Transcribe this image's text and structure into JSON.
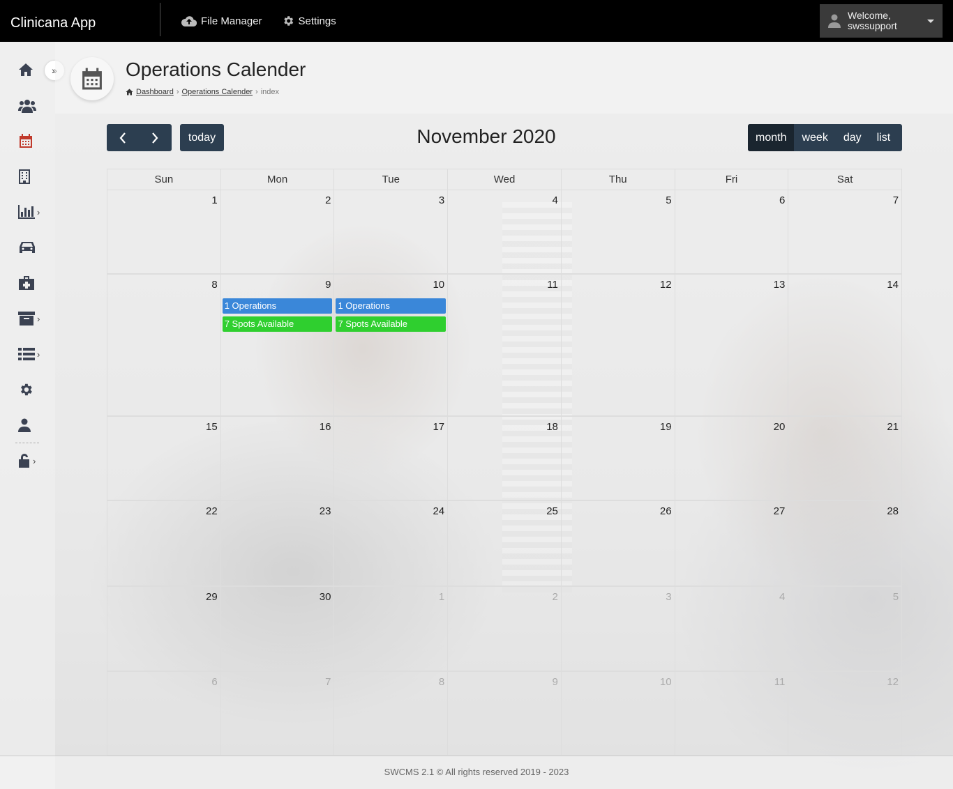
{
  "app": {
    "brand": "Clinicana App"
  },
  "topnav": {
    "file_manager": "File Manager",
    "settings": "Settings",
    "user": {
      "welcome": "Welcome,",
      "username": "swssupport"
    }
  },
  "sidebar": {
    "items": [
      {
        "icon": "home-icon"
      },
      {
        "icon": "users-icon"
      },
      {
        "icon": "calendar-icon",
        "color": "#c0392b"
      },
      {
        "icon": "building-icon"
      },
      {
        "icon": "bar-chart-icon",
        "has_submenu": true
      },
      {
        "icon": "car-icon"
      },
      {
        "icon": "medkit-icon"
      },
      {
        "icon": "archive-icon",
        "has_submenu": true
      },
      {
        "icon": "list-icon",
        "has_submenu": true
      },
      {
        "icon": "gear-icon"
      },
      {
        "icon": "user-icon"
      },
      {
        "icon": "unlock-icon",
        "has_submenu": true
      }
    ],
    "chevron": "›",
    "expand_symbol": "»"
  },
  "page": {
    "title": "Operations Calender",
    "breadcrumb": [
      "Dashboard",
      "Operations Calender",
      "index"
    ],
    "breadcrumb_sep": "›"
  },
  "calendar": {
    "title": "November 2020",
    "today_label": "today",
    "prev_symbol": "‹",
    "next_symbol": "›",
    "views": [
      "month",
      "week",
      "day",
      "list"
    ],
    "active_view": "month",
    "weekdays": [
      "Sun",
      "Mon",
      "Tue",
      "Wed",
      "Thu",
      "Fri",
      "Sat"
    ],
    "weeks": [
      [
        "1",
        "2",
        "3",
        "4",
        "5",
        "6",
        "7"
      ],
      [
        "8",
        "9",
        "10",
        "11",
        "12",
        "13",
        "14"
      ],
      [
        "15",
        "16",
        "17",
        "18",
        "19",
        "20",
        "21"
      ],
      [
        "22",
        "23",
        "24",
        "25",
        "26",
        "27",
        "28"
      ],
      [
        "29",
        "30",
        "1",
        "2",
        "3",
        "4",
        "5"
      ],
      [
        "6",
        "7",
        "8",
        "9",
        "10",
        "11",
        "12"
      ]
    ],
    "other_month_from": {
      "week": 4,
      "day": 2
    },
    "events": [
      {
        "week": 1,
        "day": 1,
        "label": "1 Operations",
        "kind": "ops"
      },
      {
        "week": 1,
        "day": 1,
        "label": "7 Spots Available",
        "kind": "spots"
      },
      {
        "week": 1,
        "day": 2,
        "label": "1 Operations",
        "kind": "ops"
      },
      {
        "week": 1,
        "day": 2,
        "label": "7 Spots Available",
        "kind": "spots"
      }
    ],
    "colors": {
      "ops": "#3a87d9",
      "spots": "#2fcf2f",
      "toolbar": "#2c3e50"
    }
  },
  "footer": {
    "text": "SWCMS 2.1 © All rights reserved 2019 - 2023"
  }
}
